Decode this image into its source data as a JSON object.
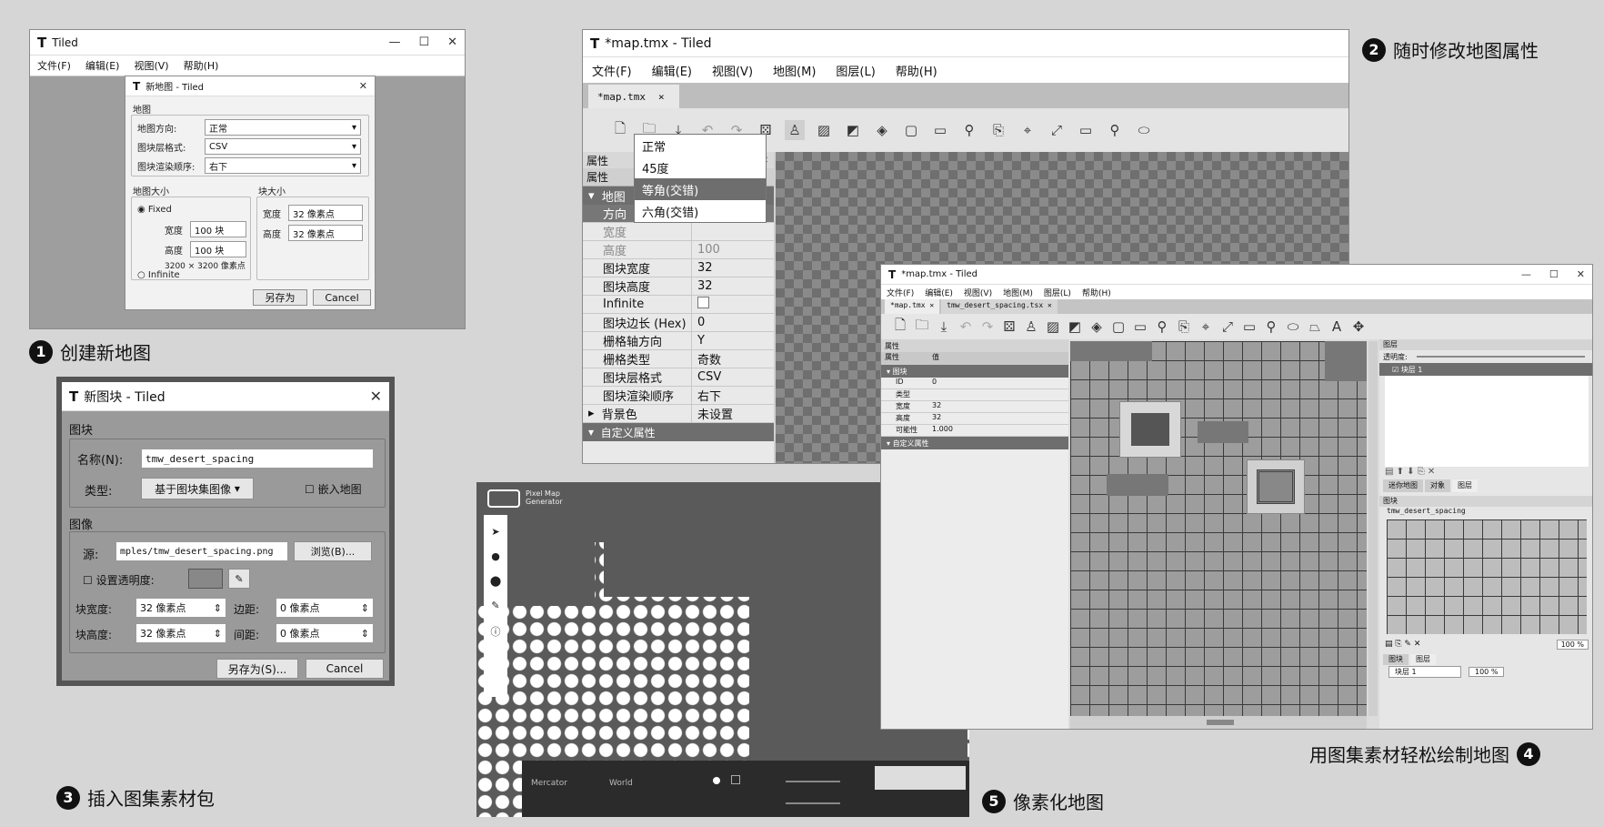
{
  "captions": {
    "c1": {
      "num": "1",
      "text": "创建新地图"
    },
    "c2": {
      "num": "2",
      "text": "随时修改地图属性"
    },
    "c3": {
      "num": "3",
      "text": "插入图集素材包"
    },
    "c4": {
      "num": "4",
      "text": "用图集素材轻松绘制地图"
    },
    "c5": {
      "num": "5",
      "text": "像素化地图"
    }
  },
  "win1": {
    "title": "Tiled",
    "menu": [
      "文件(F)",
      "编辑(E)",
      "视图(V)",
      "帮助(H)"
    ],
    "dialog": {
      "title": "新地图 - Tiled",
      "group_map": "地图",
      "orientation_label": "地图方向:",
      "orientation_value": "正常",
      "layer_format_label": "图块层格式:",
      "layer_format_value": "CSV",
      "render_order_label": "图块渲染顺序:",
      "render_order_value": "右下",
      "map_size_label": "地图大小",
      "fixed_label": "Fixed",
      "width_label": "宽度",
      "width_value": "100 块",
      "height_label": "高度",
      "height_value": "100 块",
      "size_note": "3200 × 3200 像素点",
      "infinite_label": "Infinite",
      "tile_size_label": "块大小",
      "tile_width_label": "宽度",
      "tile_width_value": "32 像素点",
      "tile_height_label": "高度",
      "tile_height_value": "32 像素点",
      "save_as": "另存为",
      "cancel": "Cancel"
    }
  },
  "win2": {
    "title": "*map.tmx - Tiled",
    "menu": [
      "文件(F)",
      "编辑(E)",
      "视图(V)",
      "地图(M)",
      "图层(L)",
      "帮助(H)"
    ],
    "tab": "*map.tmx",
    "tab_close": "×",
    "panel_title": "属性",
    "header_prop": "属性",
    "group_map": "地图",
    "rows": [
      {
        "k": "方向",
        "v": ""
      },
      {
        "k": "宽度",
        "v": ""
      },
      {
        "k": "高度",
        "v": "100"
      },
      {
        "k": "图块宽度",
        "v": "32"
      },
      {
        "k": "图块高度",
        "v": "32"
      },
      {
        "k": "Infinite",
        "v": ""
      },
      {
        "k": "图块边长 (Hex)",
        "v": "0"
      },
      {
        "k": "栅格轴方向",
        "v": "Y"
      },
      {
        "k": "栅格类型",
        "v": "奇数"
      },
      {
        "k": "图块层格式",
        "v": "CSV"
      },
      {
        "k": "图块渲染顺序",
        "v": "右下"
      },
      {
        "k": "背景色",
        "v": "未设置"
      }
    ],
    "custom_props": "自定义属性",
    "dropdown": [
      "正常",
      "45度",
      "等角(交错)",
      "六角(交错)"
    ],
    "dropdown_selected": 2
  },
  "win3": {
    "title": "新图块 - Tiled",
    "group_tileset": "图块",
    "name_label": "名称(N):",
    "name_value": "tmw_desert_spacing",
    "type_label": "类型:",
    "type_value": "基于图块集图像",
    "embed_label": "嵌入地图",
    "group_image": "图像",
    "source_label": "源:",
    "source_value": "mples/tmw_desert_spacing.png",
    "browse": "浏览(B)...",
    "transparent_label": "设置透明度:",
    "tile_width_label": "块宽度:",
    "tile_width_value": "32 像素点",
    "margin_label": "边距:",
    "margin_value": "0 像素点",
    "tile_height_label": "块高度:",
    "tile_height_value": "32 像素点",
    "spacing_label": "间距:",
    "spacing_value": "0 像素点",
    "save_as": "另存为(S)...",
    "cancel": "Cancel"
  },
  "win4": {
    "title": "*map.tmx - Tiled",
    "menu": [
      "文件(F)",
      "编辑(E)",
      "视图(V)",
      "地图(M)",
      "图层(L)",
      "帮助(H)"
    ],
    "tabs": [
      "*map.tmx",
      "tmw_desert_spacing.tsx"
    ],
    "panel_title": "属性",
    "prop_header": [
      "属性",
      "值"
    ],
    "group": "图块",
    "rows": [
      {
        "k": "ID",
        "v": "0"
      },
      {
        "k": "类型",
        "v": ""
      },
      {
        "k": "宽度",
        "v": "32"
      },
      {
        "k": "高度",
        "v": "32"
      },
      {
        "k": "可能性",
        "v": "1.000"
      }
    ],
    "custom_props": "自定义属性",
    "layers_title": "图层",
    "opacity_label": "透明度:",
    "layer_name": "块层 1",
    "right_tabs": [
      "迷你地图",
      "对象",
      "图层"
    ],
    "tileset_title": "图块",
    "tileset_tab": "tmw_desert_spacing",
    "zoom": "100 %",
    "bottom_tabs": [
      "图块",
      "图层"
    ],
    "status_layer": "块层 1",
    "status_zoom": "100 %"
  },
  "win5": {
    "app_name": "Pixel Map Generator",
    "bottom_labels": [
      "Mercator",
      "World"
    ]
  }
}
